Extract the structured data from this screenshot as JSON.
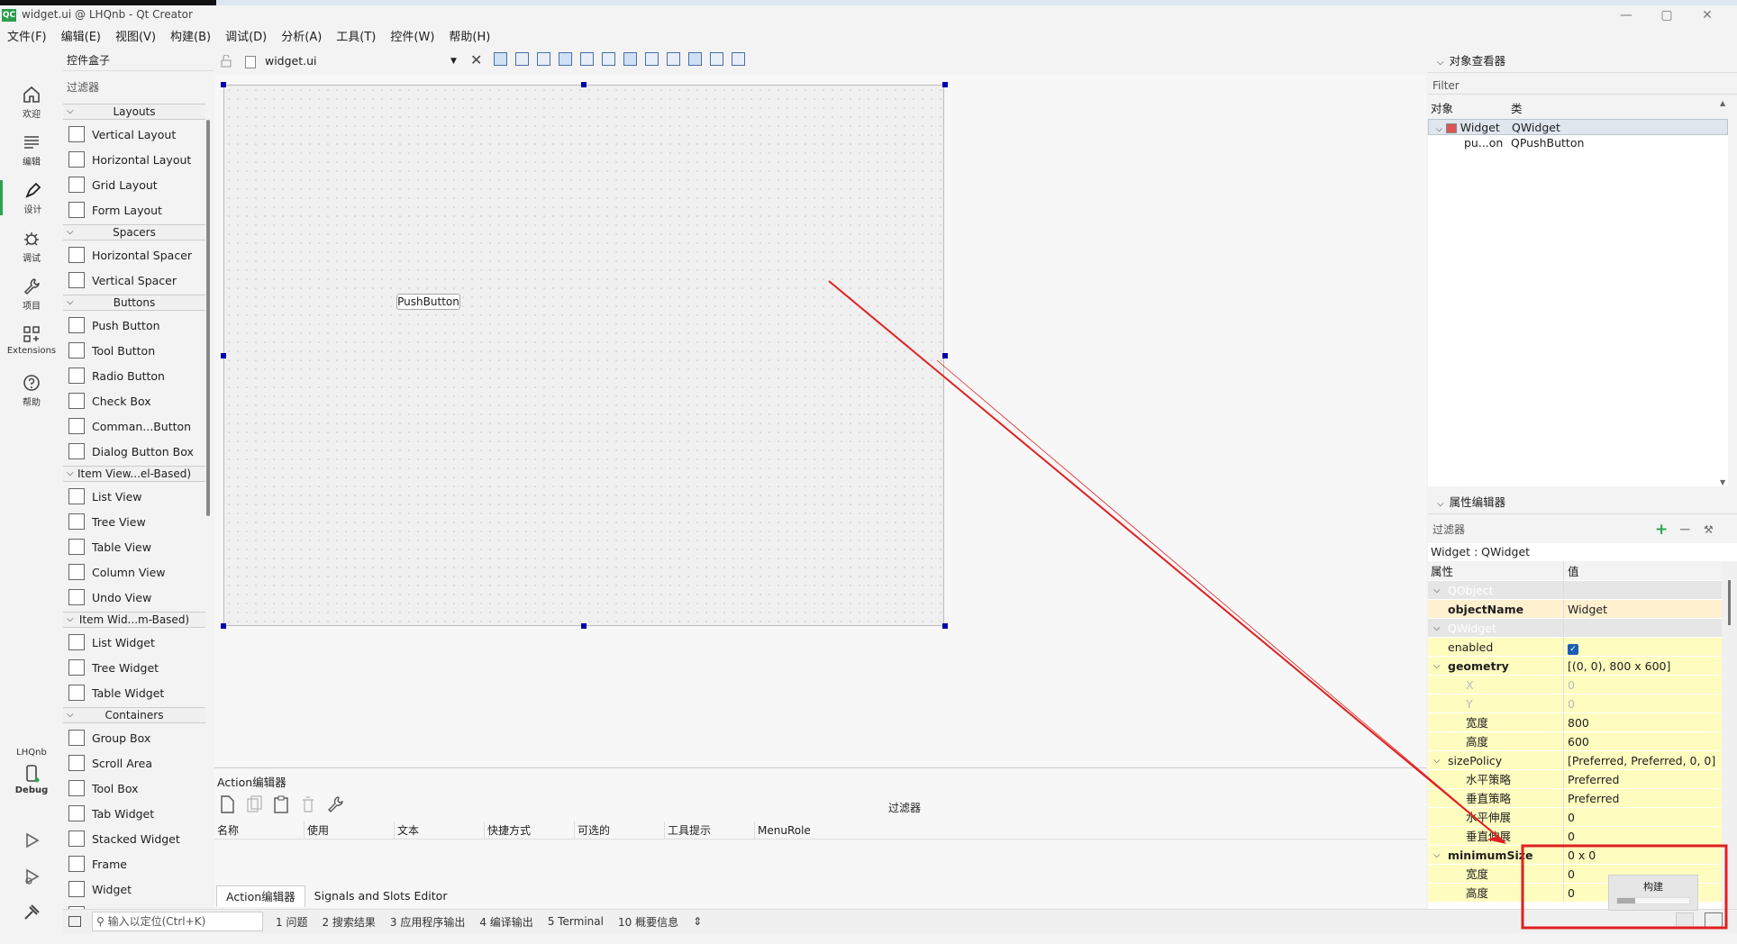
{
  "window": {
    "title": "widget.ui @ LHQnb - Qt Creator",
    "app_icon": "QC",
    "minimize": "—",
    "maximize": "▢",
    "close": "✕"
  },
  "menubar": [
    "文件(F)",
    "编辑(E)",
    "视图(V)",
    "构建(B)",
    "调试(D)",
    "分析(A)",
    "工具(T)",
    "控件(W)",
    "帮助(H)"
  ],
  "modebar": {
    "items": [
      {
        "label": "欢迎",
        "icon": "home-icon"
      },
      {
        "label": "编辑",
        "icon": "edit-lines-icon"
      },
      {
        "label": "设计",
        "icon": "pen-icon"
      },
      {
        "label": "调试",
        "icon": "bug-icon"
      },
      {
        "label": "项目",
        "icon": "wrench-icon"
      },
      {
        "label": "Extensions",
        "icon": "extensions-icon"
      },
      {
        "label": "帮助",
        "icon": "help-icon"
      }
    ],
    "kit_project": "LHQnb",
    "kit_mode": "Debug"
  },
  "widgetbox": {
    "title": "控件盒子",
    "filter": "过滤器",
    "categories": [
      {
        "name": "Layouts",
        "items": [
          "Vertical Layout",
          "Horizontal Layout",
          "Grid Layout",
          "Form Layout"
        ]
      },
      {
        "name": "Spacers",
        "items": [
          "Horizontal Spacer",
          "Vertical Spacer"
        ]
      },
      {
        "name": "Buttons",
        "items": [
          "Push Button",
          "Tool Button",
          "Radio Button",
          "Check Box",
          "Comman...Button",
          "Dialog Button Box"
        ]
      },
      {
        "name": "Item View...el-Based)",
        "items": [
          "List View",
          "Tree View",
          "Table View",
          "Column View",
          "Undo View"
        ]
      },
      {
        "name": "Item Wid...m-Based)",
        "items": [
          "List Widget",
          "Tree Widget",
          "Table Widget"
        ]
      },
      {
        "name": "Containers",
        "items": [
          "Group Box",
          "Scroll Area",
          "Tool Box",
          "Tab Widget",
          "Stacked Widget",
          "Frame",
          "Widget",
          "MDI Area"
        ]
      }
    ]
  },
  "editor": {
    "file": "widget.ui",
    "push_button": "PushButton"
  },
  "action_editor": {
    "title": "Action编辑器",
    "filter": "过滤器",
    "columns": [
      "名称",
      "使用",
      "文本",
      "快捷方式",
      "可选的",
      "工具提示",
      "MenuRole"
    ],
    "tabs": [
      "Action编辑器",
      "Signals and Slots Editor"
    ]
  },
  "statusbar": {
    "locator_placeholder": "输入以定位(Ctrl+K)",
    "items": [
      "1 问题",
      "2 搜索结果",
      "3 应用程序输出",
      "4 编译输出",
      "5 Terminal",
      "10 概要信息"
    ]
  },
  "object_inspector": {
    "title": "对象查看器",
    "filter": "Filter",
    "col_object": "对象",
    "col_class": "类",
    "rows": [
      {
        "object": "Widget",
        "class": "QWidget"
      },
      {
        "object": "pu...on",
        "class": "QPushButton"
      }
    ]
  },
  "property_editor": {
    "title": "属性编辑器",
    "filter": "过滤器",
    "object_label": "Widget : QWidget",
    "col_property": "属性",
    "col_value": "值",
    "rows": [
      {
        "k": "QObject",
        "v": ""
      },
      {
        "k": "objectName",
        "v": "Widget"
      },
      {
        "k": "QWidget",
        "v": ""
      },
      {
        "k": "enabled",
        "v": ""
      },
      {
        "k": "geometry",
        "v": "[(0, 0), 800 x 600]"
      },
      {
        "k": "X",
        "v": "0"
      },
      {
        "k": "Y",
        "v": "0"
      },
      {
        "k": "宽度",
        "v": "800"
      },
      {
        "k": "高度",
        "v": "600"
      },
      {
        "k": "sizePolicy",
        "v": "[Preferred, Preferred, 0, 0]"
      },
      {
        "k": "水平策略",
        "v": "Preferred"
      },
      {
        "k": "垂直策略",
        "v": "Preferred"
      },
      {
        "k": "水平伸展",
        "v": "0"
      },
      {
        "k": "垂直伸展",
        "v": "0"
      },
      {
        "k": "minimumSize",
        "v": "0 x 0"
      },
      {
        "k": "宽度",
        "v": "0"
      },
      {
        "k": "高度",
        "v": "0"
      }
    ]
  },
  "build_popup": {
    "label": "构建"
  },
  "colors": {
    "annotation": "#e02020",
    "accent": "#2ea44f",
    "highlight": "#fffcc0"
  }
}
